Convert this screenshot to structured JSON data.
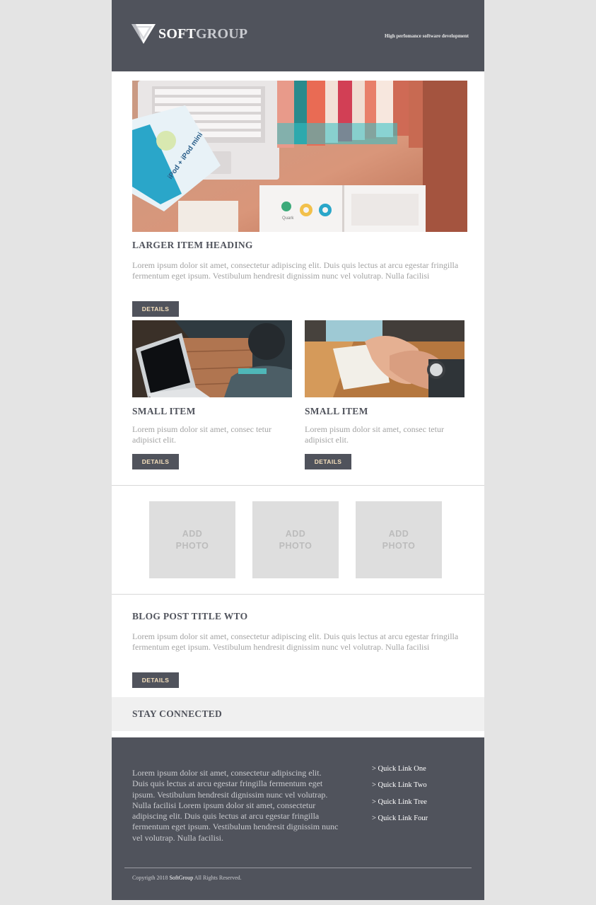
{
  "header": {
    "logo_soft": "SOFT",
    "logo_group": "GROUP",
    "tagline": "High perfomance software development"
  },
  "featured": {
    "heading": "LARGER ITEM HEADING",
    "text": "Lorem ipsum dolor sit amet, consectetur adipiscing elit. Duis quis lectus at arcu egestar fringilla fermentum eget ipsum. Vestibulum hendresit dignissim nunc vel volutrap. Nulla facilisi",
    "button": "DETAILS",
    "image_labels": [
      "iPod + iPod mini",
      "Quark"
    ]
  },
  "small_items": [
    {
      "heading": "SMALL ITEM",
      "text": "Lorem pisum dolor sit amet, consec tetur adipisict elit.",
      "button": "DETAILS"
    },
    {
      "heading": "SMALL ITEM",
      "text": "Lorem pisum dolor sit amet, consec tetur adipisict elit.",
      "button": "DETAILS"
    }
  ],
  "photos": [
    {
      "line1": "ADD",
      "line2": "PHOTO"
    },
    {
      "line1": "ADD",
      "line2": "PHOTO"
    },
    {
      "line1": "ADD",
      "line2": "PHOTO"
    }
  ],
  "blog": {
    "title": "BLOG POST TITLE WTO",
    "text": "Lorem ipsum dolor sit amet, consectetur adipiscing elit. Duis quis lectus at arcu egestar fringilla fermentum eget ipsum. Vestibulum hendresit dignissim nunc vel volutrap. Nulla facilisi",
    "button": "DETAILS"
  },
  "stay_connected": "STAY CONNECTED",
  "footer": {
    "text": "Lorem ipsum dolor sit amet, consectetur adipiscing elit. Duis quis lectus at arcu egestar fringilla fermentum eget ipsum. Vestibulum hendresit dignissim nunc vel volutrap. Nulla facilisi Lorem ipsum dolor sit amet, consectetur adipiscing elit. Duis quis lectus at arcu egestar fringilla fermentum eget ipsum. Vestibulum hendresit dignissim nunc vel volutrap. Nulla facilisi.",
    "quick_links": [
      "> Quick Link One",
      "> Quick Link Two",
      "> Quick Link Tree",
      "> Quick Link Four"
    ],
    "copyright_prefix": "Copyrigth 2018",
    "copyright_brand": "SoftGroup",
    "copyright_suffix": "All Rights Reserved."
  },
  "colors": {
    "header_bg": "#50535c",
    "button_text": "#f6e1bd",
    "placeholder_bg": "#dedede",
    "stay_bg": "#f0f0f0"
  }
}
